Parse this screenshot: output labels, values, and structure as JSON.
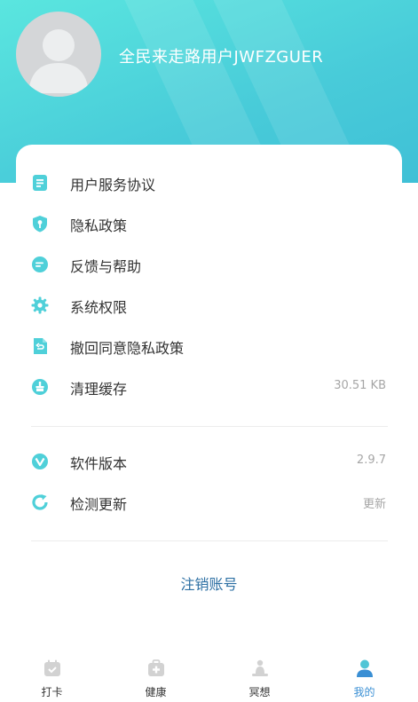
{
  "colors": {
    "accent": "#4fd0d9",
    "link": "#2c6fa3",
    "tab_active": "#3a8fd4",
    "tab_inactive": "#cfcfcf"
  },
  "profile": {
    "username": "全民来走路用户JWFZGUER",
    "avatar_icon": "avatar-icon"
  },
  "menu": {
    "items": [
      {
        "label": "用户服务协议",
        "icon": "document-icon"
      },
      {
        "label": "隐私政策",
        "icon": "shield-key-icon"
      },
      {
        "label": "反馈与帮助",
        "icon": "chat-icon"
      },
      {
        "label": "系统权限",
        "icon": "gear-icon"
      },
      {
        "label": "撤回同意隐私政策",
        "icon": "file-revoke-icon"
      },
      {
        "label": "清理缓存",
        "icon": "broom-icon",
        "value": "30.51 KB"
      }
    ]
  },
  "about": {
    "items": [
      {
        "label": "软件版本",
        "icon": "version-icon",
        "value": "2.9.7"
      },
      {
        "label": "检测更新",
        "icon": "refresh-icon",
        "value": "更新"
      }
    ]
  },
  "logout_label": "注销账号",
  "tabs": [
    {
      "label": "打卡",
      "icon": "calendar-check-icon",
      "active": false
    },
    {
      "label": "健康",
      "icon": "medical-kit-icon",
      "active": false
    },
    {
      "label": "冥想",
      "icon": "meditation-icon",
      "active": false
    },
    {
      "label": "我的",
      "icon": "person-icon",
      "active": true
    }
  ]
}
